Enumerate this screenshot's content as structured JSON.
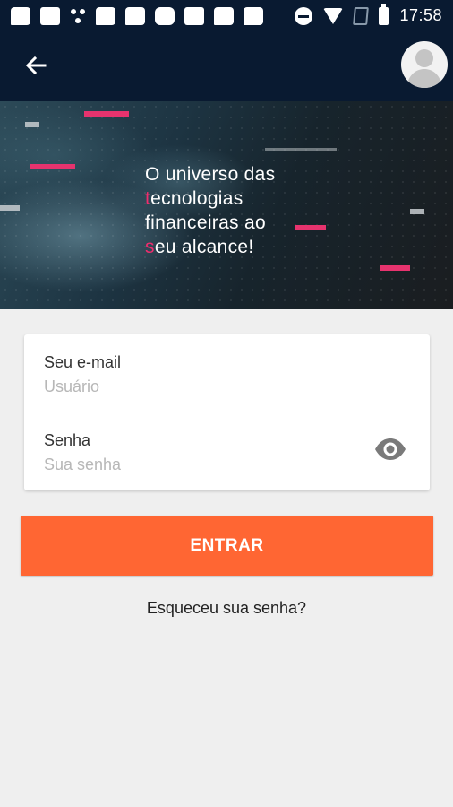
{
  "status_bar": {
    "time": "17:58",
    "icons": [
      "messages-icon",
      "image-icon",
      "share-icon",
      "chat-icon",
      "chat-icon",
      "app-icon",
      "notes-icon",
      "chat-icon",
      "chat-icon",
      "do-not-disturb-icon",
      "wifi-icon",
      "no-sim-icon",
      "battery-icon"
    ]
  },
  "app_bar": {
    "back_icon": "arrow-back-icon",
    "avatar_icon": "user-avatar-icon"
  },
  "banner": {
    "line1": "O universo das",
    "line2_accent": "t",
    "line2_rest": "ecnologias",
    "line3": "financeiras ao",
    "line4_accent": "s",
    "line4_rest": "eu alcance!"
  },
  "login_form": {
    "email_label": "Seu e-mail",
    "email_placeholder": "Usuário",
    "email_value": "",
    "password_label": "Senha",
    "password_placeholder": "Sua senha",
    "password_value": "",
    "password_toggle_icon": "eye-icon"
  },
  "actions": {
    "submit_label": "ENTRAR",
    "forgot_label": "Esqueceu sua senha?"
  },
  "colors": {
    "header": "#091a31",
    "accent": "#ff6633",
    "tagline_accent": "#ef2d6e",
    "background": "#efefef"
  }
}
